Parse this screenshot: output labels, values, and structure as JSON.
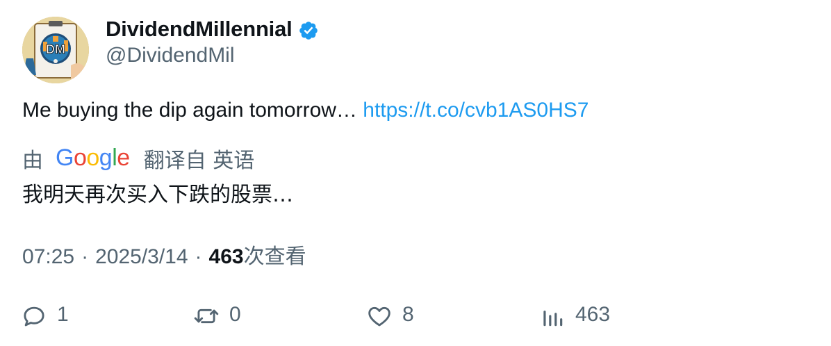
{
  "author": {
    "display_name": "DividendMillennial",
    "handle": "@DividendMil",
    "verified": true,
    "avatar_icon": "dm-logo-avatar",
    "avatar_logo_text": "DM"
  },
  "tweet": {
    "text": "Me buying the dip again tomorrow… ",
    "link": "https://t.co/cvb1AS0HS7"
  },
  "translation": {
    "prefix": "由",
    "provider_letters": [
      "G",
      "o",
      "o",
      "g",
      "l",
      "e"
    ],
    "suffix": "翻译自 英语",
    "translated_text": "我明天再次买入下跌的股票…"
  },
  "meta": {
    "time": "07:25",
    "date": "2025/3/14",
    "separator": "·",
    "views_count": "463",
    "views_label": "次查看"
  },
  "actions": {
    "reply_count": "1",
    "retweet_count": "0",
    "like_count": "8",
    "views_count": "463"
  },
  "colors": {
    "link": "#1d9bf0",
    "secondary_text": "#536471",
    "primary_text": "#0f1419",
    "verified_badge": "#1d9bf0"
  }
}
